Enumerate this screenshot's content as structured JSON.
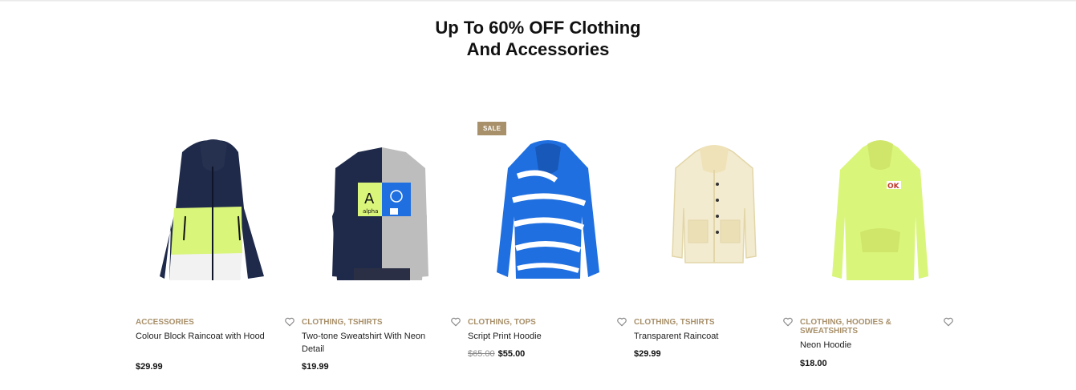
{
  "section": {
    "title_line1": "Up To 60% OFF Clothing",
    "title_line2": "And Accessories"
  },
  "products": [
    {
      "categories": "ACCESSORIES",
      "name": "Colour Block Raincoat with Hood",
      "price": "$29.99",
      "old_price": null,
      "badge": null
    },
    {
      "categories": "CLOTHING, TSHIRTS",
      "name": "Two-tone Sweatshirt With Neon Detail",
      "price": "$19.99",
      "old_price": null,
      "badge": null,
      "print_letter": "A",
      "print_word": "alpha"
    },
    {
      "categories": "CLOTHING, TOPS",
      "name": "Script Print Hoodie",
      "price": "$55.00",
      "old_price": "$65.00",
      "badge": "SALE"
    },
    {
      "categories": "CLOTHING, TSHIRTS",
      "name": "Transparent Raincoat",
      "price": "$29.99",
      "old_price": null,
      "badge": null
    },
    {
      "categories": "CLOTHING, HOODIES & SWEATSHIRTS",
      "name": "Neon Hoodie",
      "price": "$18.00",
      "old_price": null,
      "badge": null,
      "print_word": "OK"
    }
  ],
  "colors": {
    "accent": "#a8906a",
    "navy": "#1f2a4a",
    "neon": "#d9f57a",
    "royal_blue": "#1f6fe0",
    "clear_cream": "#f3ebcf"
  },
  "icons": {
    "wishlist": "heart-outline-icon"
  }
}
